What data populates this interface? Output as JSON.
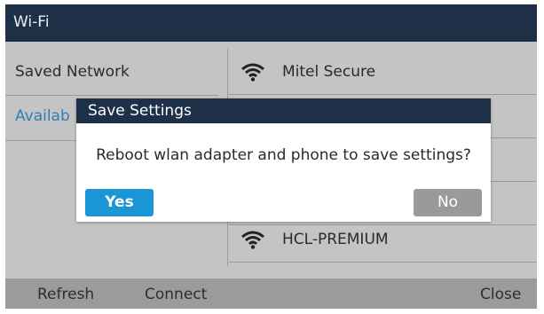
{
  "window": {
    "title": "Wi-Fi"
  },
  "left_menu": {
    "items": [
      {
        "label": "Saved Network"
      },
      {
        "label": "Availab"
      }
    ]
  },
  "networks": [
    {
      "name": "Mitel Secure",
      "icon": "wifi-icon"
    },
    {
      "name": "HCL-PREMIUM",
      "icon": "wifi-icon"
    }
  ],
  "dialog": {
    "title": "Save Settings",
    "message": "Reboot wlan adapter and phone to save settings?",
    "yes_label": "Yes",
    "no_label": "No"
  },
  "softkeys": {
    "refresh": "Refresh",
    "connect": "Connect",
    "close": "Close"
  },
  "colors": {
    "titlebar": "#1d3047",
    "accent_link": "#2f7fb8",
    "yes_button": "#1a96d6",
    "no_button": "#9a9a9a",
    "background": "#c4c4c4"
  }
}
